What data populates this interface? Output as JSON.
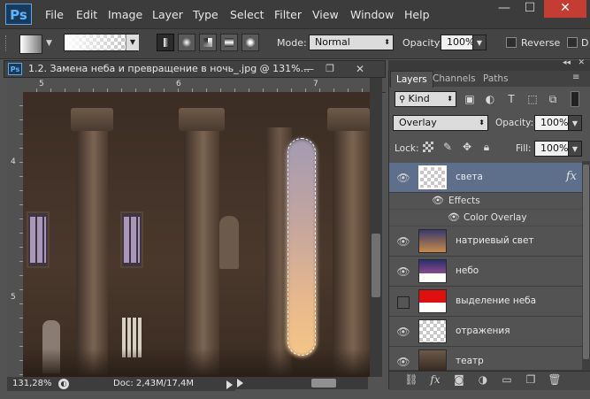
{
  "app": {
    "logo": "Ps"
  },
  "menu": [
    "File",
    "Edit",
    "Image",
    "Layer",
    "Type",
    "Select",
    "Filter",
    "View",
    "Window",
    "Help"
  ],
  "window_controls": {
    "minimize": "—",
    "maximize": "☐",
    "close": "✕"
  },
  "options": {
    "mode_label": "Mode:",
    "mode_value": "Normal",
    "opacity_label": "Opacity:",
    "opacity_value": "100%",
    "reverse_label": "Reverse",
    "dither_label": "D"
  },
  "document": {
    "title": "1.2. Замена неба и превращение в ночь_.jpg @ 131%...",
    "ruler_h": [
      "5",
      "6",
      "7"
    ],
    "ruler_v": [
      "4",
      "5"
    ],
    "zoom": "131,28%",
    "doc_size": "Doc: 2,43M/17,4M"
  },
  "panel": {
    "tabs": [
      "Layers",
      "Channels",
      "Paths"
    ],
    "filter_kind": "Kind",
    "blend_mode": "Overlay",
    "opacity_label": "Opacity:",
    "opacity_value": "100%",
    "lock_label": "Lock:",
    "fill_label": "Fill:",
    "fill_value": "100%",
    "fx_symbol": "fx",
    "effects_label": "Effects",
    "color_overlay_label": "Color Overlay",
    "layers": [
      {
        "name": "света",
        "selected": true
      },
      {
        "name": "натриевый свет"
      },
      {
        "name": "небо"
      },
      {
        "name": "выделение неба"
      },
      {
        "name": "отражения"
      },
      {
        "name": "театр"
      }
    ]
  },
  "colors": {
    "selected_layer": "#5e6f8c",
    "accent_ps": "#5fb4ff"
  }
}
